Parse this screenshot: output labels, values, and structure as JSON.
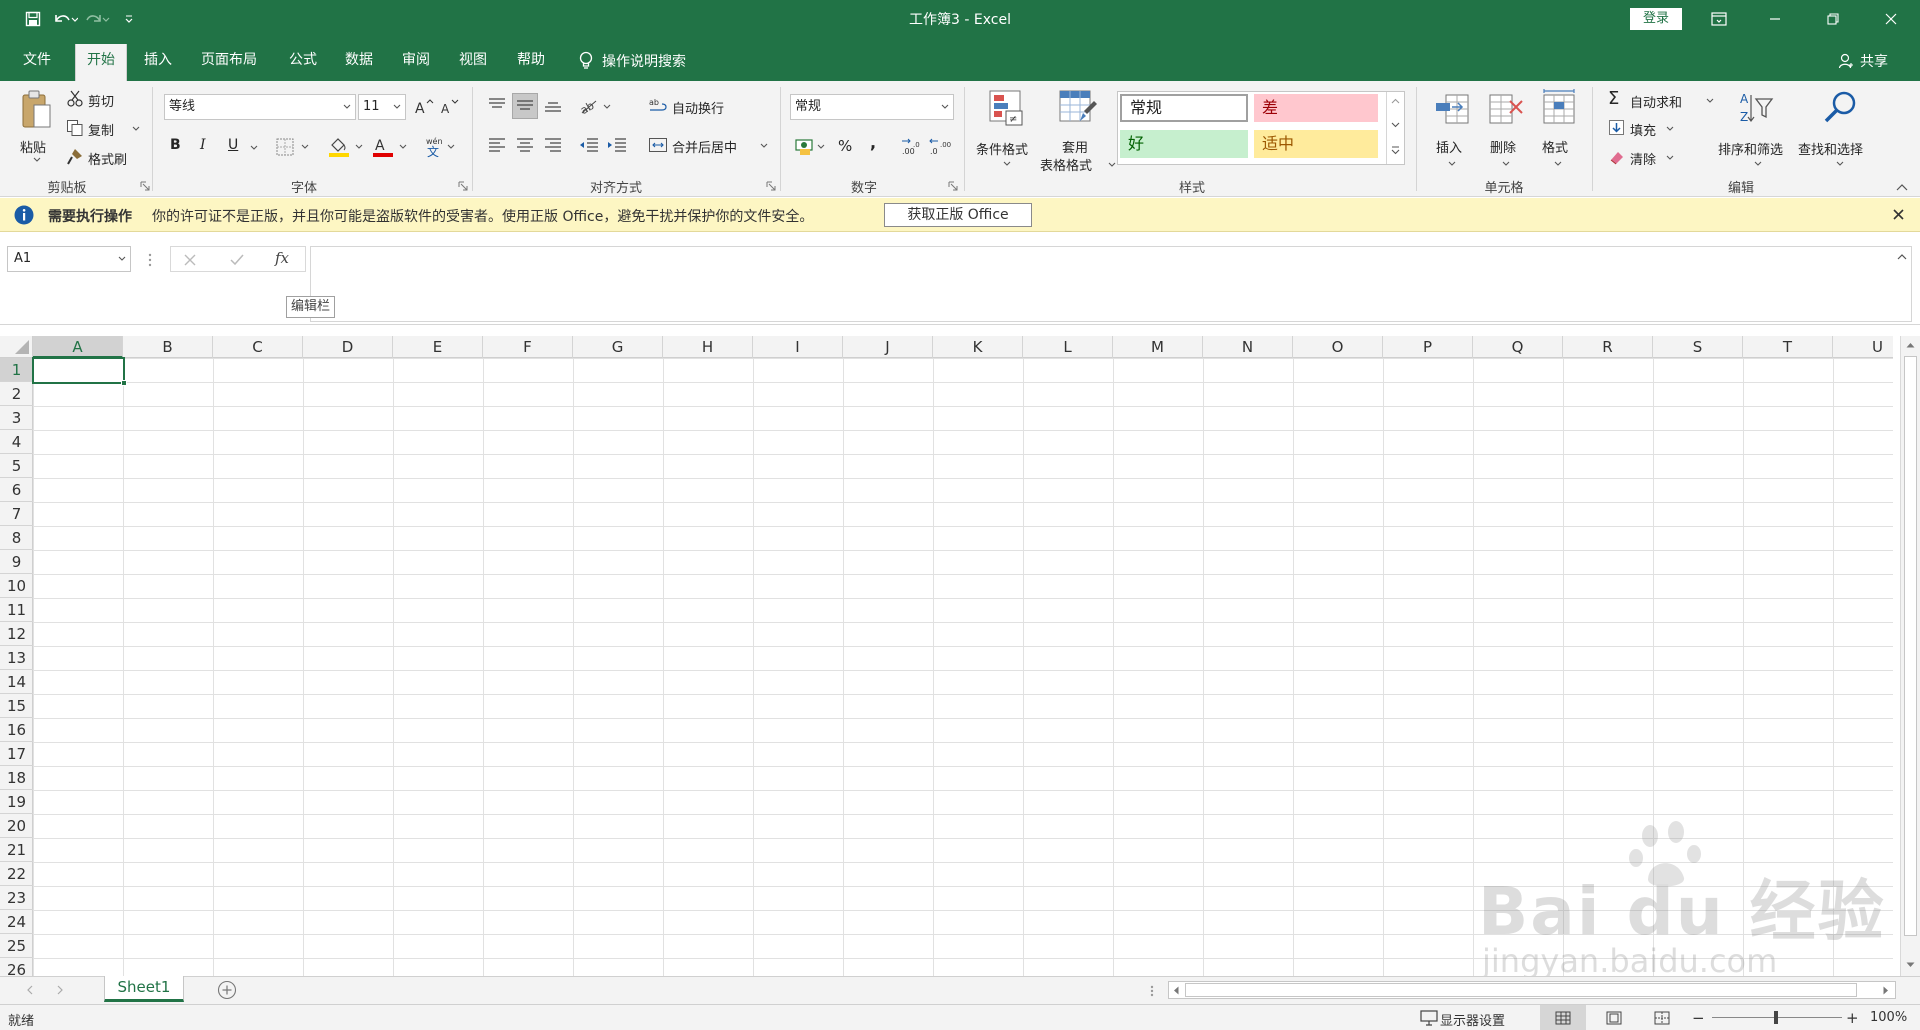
{
  "window": {
    "title": "工作簿3  -  Excel",
    "login_label": "登录",
    "accent": "#217346"
  },
  "tabs": [
    {
      "label": "文件"
    },
    {
      "label": "开始"
    },
    {
      "label": "插入"
    },
    {
      "label": "页面布局"
    },
    {
      "label": "公式"
    },
    {
      "label": "数据"
    },
    {
      "label": "审阅"
    },
    {
      "label": "视图"
    },
    {
      "label": "帮助"
    }
  ],
  "active_tab": "开始",
  "tell_me": "操作说明搜索",
  "share_label": "共享",
  "ribbon": {
    "clipboard": {
      "paste": "粘贴",
      "cut": "剪切",
      "copy": "复制",
      "format_painter": "格式刷",
      "label": "剪贴板"
    },
    "font": {
      "font_name": "等线",
      "font_size": "11",
      "bold": "B",
      "italic": "I",
      "underline": "U",
      "label": "字体"
    },
    "alignment": {
      "wrap_text": "自动换行",
      "merge_center": "合并后居中",
      "label": "对齐方式"
    },
    "number": {
      "format": "常规",
      "percent": "%",
      "comma": ",",
      "label": "数字"
    },
    "styles": {
      "conditional": "条件格式",
      "format_table_1": "套用",
      "format_table_2": "表格格式",
      "cell_normal": "常规",
      "cell_bad": "差",
      "cell_good": "好",
      "cell_neutral": "适中",
      "label": "样式",
      "colors": {
        "bad_bg": "#ffc7ce",
        "bad_fg": "#9c0006",
        "good_bg": "#c6efce",
        "good_fg": "#006100",
        "neutral_bg": "#ffeb9c",
        "neutral_fg": "#9c5700"
      }
    },
    "cells": {
      "insert": "插入",
      "delete": "删除",
      "format": "格式",
      "label": "单元格"
    },
    "editing": {
      "autosum": "自动求和",
      "fill": "填充",
      "clear": "清除",
      "sort_filter": "排序和筛选",
      "find_select": "查找和选择",
      "label": "编辑"
    }
  },
  "notice": {
    "title": "需要执行操作",
    "message": "你的许可证不是正版，并且你可能是盗版软件的受害者。使用正版 Office，避免干扰并保护你的文件安全。",
    "button": "获取正版 Office"
  },
  "formula_bar": {
    "name_box": "A1",
    "fx": "fx",
    "tooltip": "编辑栏",
    "content": ""
  },
  "grid": {
    "columns": [
      "A",
      "B",
      "C",
      "D",
      "E",
      "F",
      "G",
      "H",
      "I",
      "J",
      "K",
      "L",
      "M",
      "N",
      "O",
      "P",
      "Q",
      "R",
      "S",
      "T",
      "U"
    ],
    "rows": [
      "1",
      "2",
      "3",
      "4",
      "5",
      "6",
      "7",
      "8",
      "9",
      "10",
      "11",
      "12",
      "13",
      "14",
      "15",
      "16",
      "17",
      "18",
      "19",
      "20",
      "21",
      "22",
      "23",
      "24",
      "25",
      "26"
    ],
    "active_cell": "A1"
  },
  "sheets": [
    {
      "name": "Sheet1"
    }
  ],
  "statusbar": {
    "ready": "就绪",
    "display_settings": "显示器设置",
    "zoom": "100%"
  },
  "watermark": {
    "brand": "Bai du 经验",
    "url": "jingyan.baidu.com"
  }
}
